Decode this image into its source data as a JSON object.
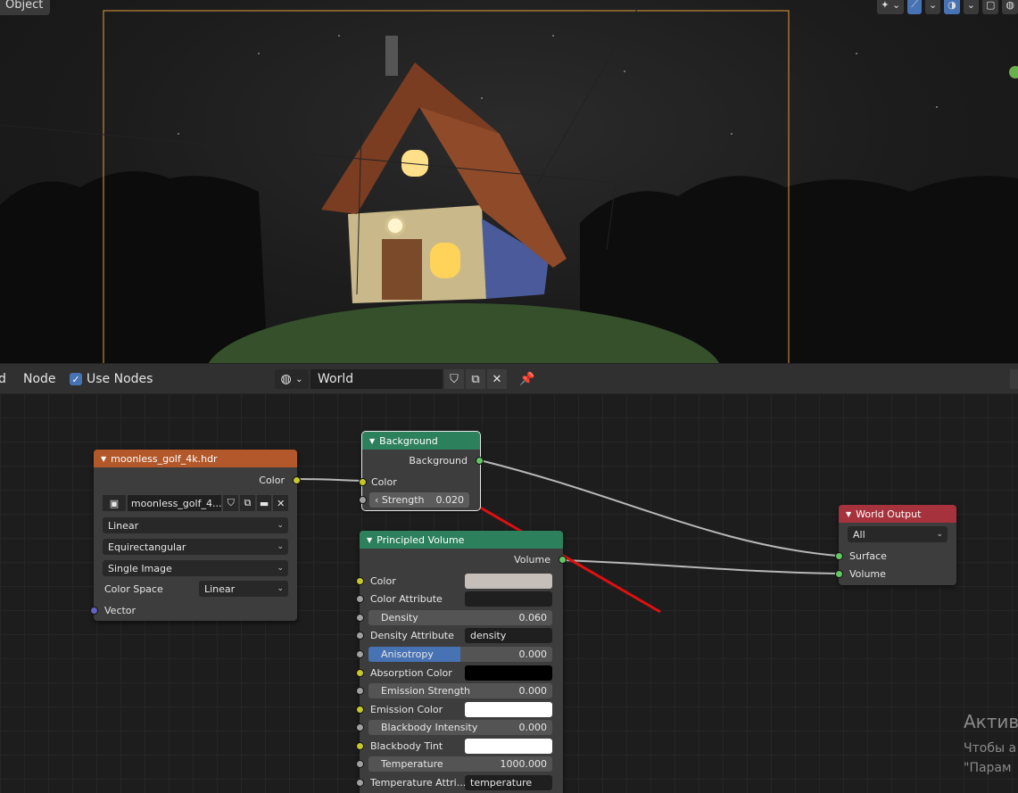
{
  "viewport": {
    "mode_label": "Object",
    "tools": [
      "gizmo-icon",
      "overlay-icon",
      "shading-icon",
      "camera-icon",
      "globe-icon"
    ]
  },
  "header": {
    "menu_node": "Node",
    "menu_partial": "d",
    "use_nodes_label": "Use Nodes",
    "use_nodes_checked": true,
    "world_name": "World"
  },
  "nodes": {
    "image": {
      "title": "moonless_golf_4k.hdr",
      "output_color": "Color",
      "image_name": "moonless_golf_4...",
      "interpolation": "Linear",
      "projection": "Equirectangular",
      "source": "Single Image",
      "color_space_label": "Color Space",
      "color_space": "Linear",
      "input_vector": "Vector"
    },
    "background": {
      "title": "Background",
      "output": "Background",
      "input_color": "Color",
      "strength_label": "Strength",
      "strength_value": "0.020"
    },
    "volume": {
      "title": "Principled Volume",
      "output": "Volume",
      "color_label": "Color",
      "color_value": "#c6beb8",
      "color_attr_label": "Color Attribute",
      "density_label": "Density",
      "density_value": "0.060",
      "density_attr_label": "Density Attribute",
      "density_attr_value": "density",
      "anisotropy_label": "Anisotropy",
      "anisotropy_value": "0.000",
      "absorption_label": "Absorption Color",
      "absorption_value": "#000000",
      "emission_strength_label": "Emission Strength",
      "emission_strength_value": "0.000",
      "emission_color_label": "Emission Color",
      "emission_color_value": "#ffffff",
      "blackbody_label": "Blackbody Intensity",
      "blackbody_value": "0.000",
      "blackbody_tint_label": "Blackbody Tint",
      "blackbody_tint_value": "#ffffff",
      "temperature_label": "Temperature",
      "temperature_value": "1000.000",
      "temperature_attr_label": "Temperature Attri...",
      "temperature_attr_value": "temperature"
    },
    "output": {
      "title": "World Output",
      "target": "All",
      "surface": "Surface",
      "volume": "Volume"
    }
  },
  "watermark": {
    "line1": "Актив",
    "line2": "Чтобы а",
    "line3": "\"Парам"
  },
  "colors": {
    "arrow": "#e01010",
    "image_header": "#b2582a",
    "shader_header": "#2c805c",
    "output_header": "#a5323c"
  }
}
